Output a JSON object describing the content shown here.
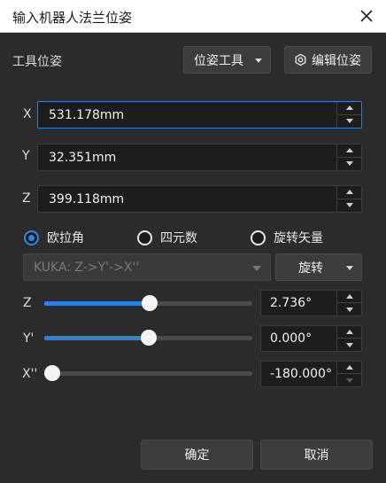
{
  "window": {
    "title": "输入机器人法兰位姿",
    "close_icon": "close-icon"
  },
  "toolbar": {
    "section_label": "工具位姿",
    "tool_dropdown": "位姿工具",
    "edit_button": "编辑位姿",
    "edit_icon": "gear-icon"
  },
  "position": {
    "x": {
      "label": "X",
      "value": "531.178mm"
    },
    "y": {
      "label": "Y",
      "value": "32.351mm"
    },
    "z": {
      "label": "Z",
      "value": "399.118mm"
    }
  },
  "rotation_mode": {
    "options": [
      "欧拉角",
      "四元数",
      "旋转矢量"
    ],
    "selected": "欧拉角"
  },
  "euler": {
    "convention": "KUKA: Z->Y'->X''",
    "rotate_button": "旋转"
  },
  "angles": [
    {
      "label": "Z",
      "value": "2.736°",
      "fraction": 0.5076
    },
    {
      "label": "Y'",
      "value": "0.000°",
      "fraction": 0.5
    },
    {
      "label": "X''",
      "value": "-180.000°",
      "fraction": 0.0
    }
  ],
  "footer": {
    "ok": "确定",
    "cancel": "取消"
  },
  "colors": {
    "accent": "#2f86e6",
    "background": "#2b2b2b"
  }
}
